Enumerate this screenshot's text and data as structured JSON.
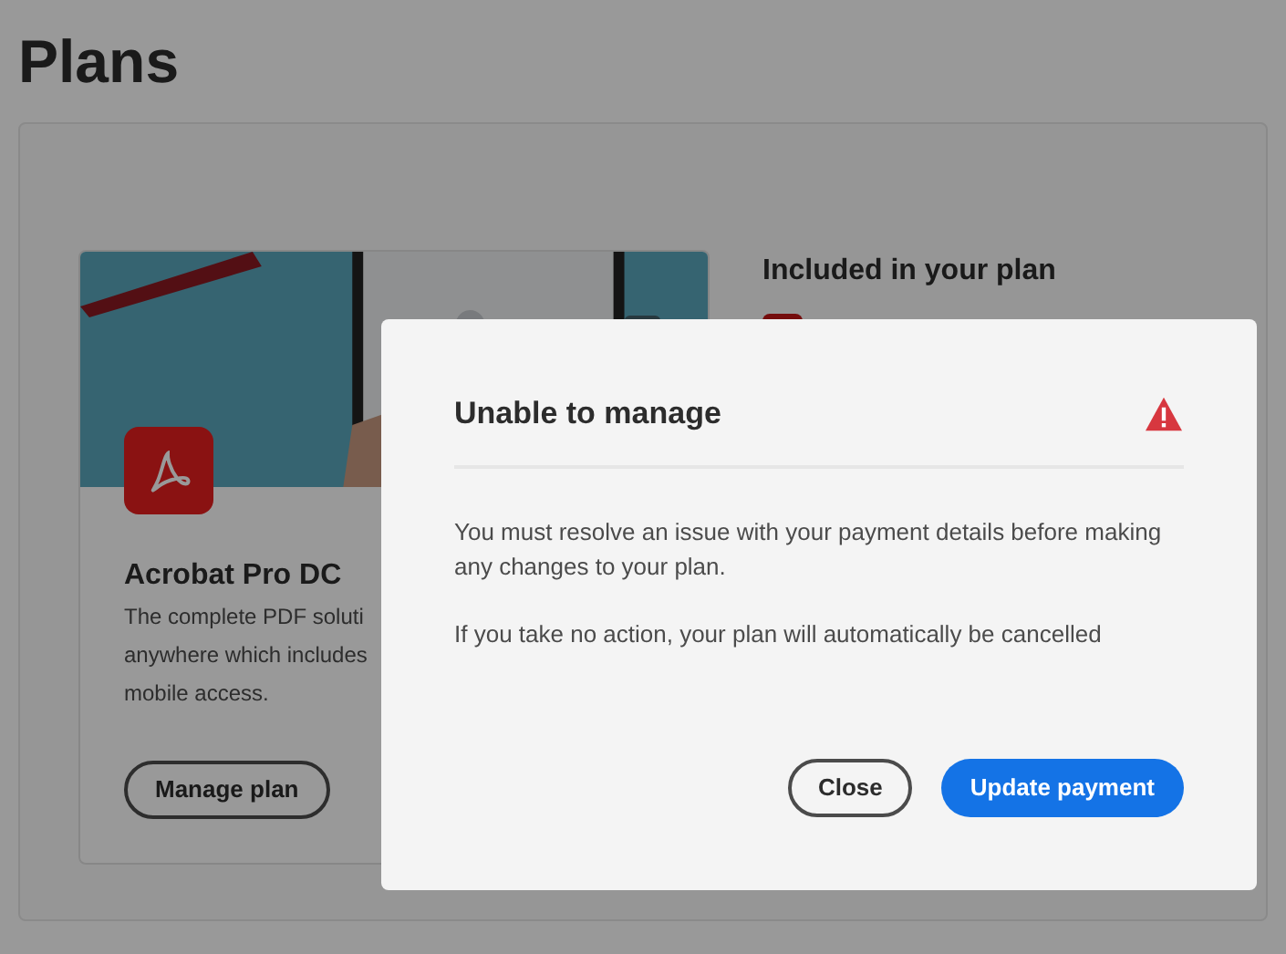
{
  "page": {
    "title": "Plans"
  },
  "plan_card": {
    "name": "Acrobat Pro DC",
    "description_lines": [
      "The complete PDF soluti",
      "anywhere which includes",
      "mobile access."
    ],
    "button": "Manage plan"
  },
  "included": {
    "title": "Included in your plan"
  },
  "dialog": {
    "title": "Unable to manage",
    "paragraphs": [
      "You must resolve an issue with your payment details before making any changes to your plan.",
      "If you take no action, your plan will automatically be cancelled"
    ],
    "buttons": [
      {
        "label": "Close",
        "kind": "secondary"
      },
      {
        "label": "Update payment",
        "kind": "primary"
      }
    ]
  }
}
